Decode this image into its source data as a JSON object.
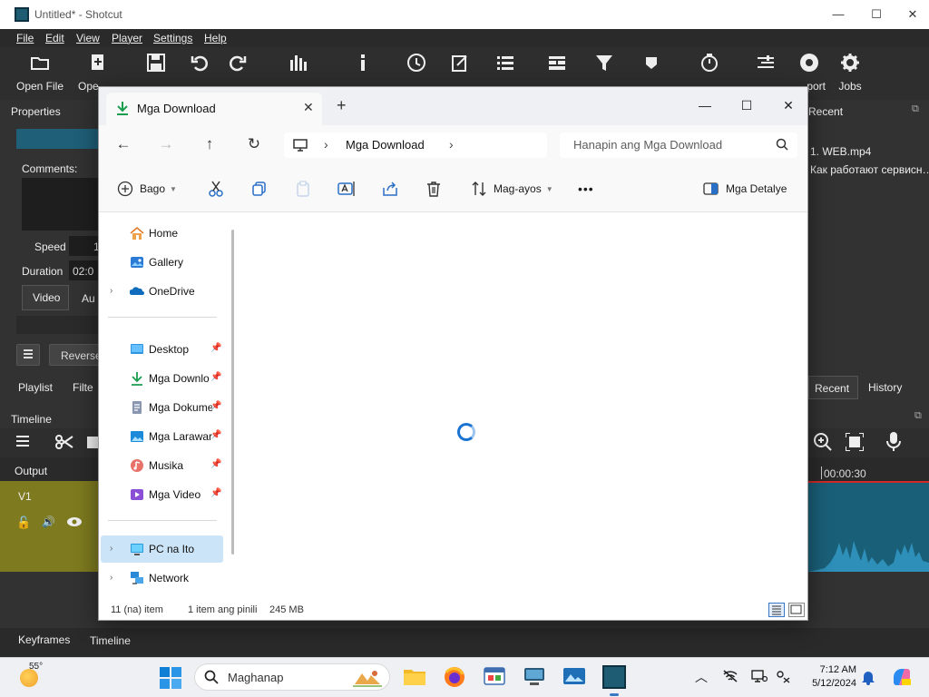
{
  "shotcut": {
    "title": "Untitled* - Shotcut",
    "menu": [
      "File",
      "Edit",
      "View",
      "Player",
      "Settings",
      "Help"
    ],
    "toolbar": [
      {
        "label": "Open File",
        "icon": "folder-icon"
      },
      {
        "label": "Ope",
        "icon": "open-other-icon"
      },
      {
        "label": "",
        "icon": "save-icon"
      },
      {
        "label": "",
        "icon": "undo-icon"
      },
      {
        "label": "",
        "icon": "redo-icon"
      },
      {
        "label": "",
        "icon": "peak-meter-icon"
      },
      {
        "label": "",
        "icon": "info-icon"
      },
      {
        "label": "",
        "icon": "history-icon"
      },
      {
        "label": "",
        "icon": "notes-icon"
      },
      {
        "label": "",
        "icon": "playlist-icon"
      },
      {
        "label": "",
        "icon": "timeline-icon"
      },
      {
        "label": "",
        "icon": "filter-icon"
      },
      {
        "label": "",
        "icon": "markers-icon"
      },
      {
        "label": "",
        "icon": "keyframes-icon"
      },
      {
        "label": "",
        "icon": "mixer-icon"
      },
      {
        "label": "port",
        "icon": "export-icon"
      },
      {
        "label": "Jobs",
        "icon": "jobs-icon"
      }
    ],
    "properties": {
      "title": "Properties",
      "comments_label": "Comments:",
      "speed_label": "Speed",
      "speed_value": "1",
      "duration_label": "Duration",
      "duration_value": "02:0",
      "tabs": [
        "Video",
        "Au"
      ],
      "reverse_label": "Reverse"
    },
    "recent": {
      "title": "Recent",
      "items": [
        "1. WEB.mp4",
        "Как работают сервисн…"
      ]
    },
    "left_tabs": [
      "Playlist",
      "Filte"
    ],
    "right_tabs": [
      "Recent",
      "History"
    ],
    "timeline": {
      "title": "Timeline",
      "output_label": "Output",
      "track_label": "V1",
      "timecode": "00:00:30"
    },
    "bottom_tabs": [
      "Keyframes",
      "Timeline"
    ]
  },
  "explorer": {
    "tab_title": "Mga Download",
    "address_path": "Mga Download",
    "search_placeholder": "Hanapin ang Mga Download",
    "commands": {
      "new_label": "Bago",
      "sort_label": "Mag-ayos",
      "more_label": "•••",
      "details_label": "Mga Detalye"
    },
    "nav": [
      {
        "label": "Home",
        "icon": "home-icon",
        "pinned": false,
        "chevron": false
      },
      {
        "label": "Gallery",
        "icon": "gallery-icon",
        "pinned": false,
        "chevron": false
      },
      {
        "label": "OneDrive",
        "icon": "onedrive-icon",
        "pinned": false,
        "chevron": true
      },
      {
        "label": "Desktop",
        "icon": "desktop-icon",
        "pinned": true,
        "chevron": false
      },
      {
        "label": "Mga Downlo",
        "icon": "download-icon",
        "pinned": true,
        "chevron": false
      },
      {
        "label": "Mga Dokume",
        "icon": "document-icon",
        "pinned": true,
        "chevron": false
      },
      {
        "label": "Mga Larawar",
        "icon": "pictures-icon",
        "pinned": true,
        "chevron": false
      },
      {
        "label": "Musika",
        "icon": "music-icon",
        "pinned": true,
        "chevron": false
      },
      {
        "label": "Mga Video",
        "icon": "video-icon",
        "pinned": true,
        "chevron": false
      },
      {
        "label": "PC na Ito",
        "icon": "this-pc-icon",
        "pinned": false,
        "chevron": true
      },
      {
        "label": "Network",
        "icon": "network-icon",
        "pinned": false,
        "chevron": true
      }
    ],
    "status": {
      "item_count": "11 (na) item",
      "selected": "1 item ang pinili",
      "size": "245 MB"
    }
  },
  "taskbar": {
    "temperature": "55°",
    "search_placeholder": "Maghanap",
    "time": "7:12 AM",
    "date": "5/12/2024",
    "apps": [
      "file-explorer-icon",
      "firefox-icon",
      "app-icon",
      "app-icon-2",
      "app-icon-3",
      "shotcut-icon"
    ]
  },
  "colors": {
    "accent": "#1a73d1",
    "selection": "#cce4f7",
    "shotcut_bg": "#323232",
    "timeline_track": "#7d7a1f",
    "waveform": "#1a6c88",
    "playhead": "#d12a2a"
  }
}
